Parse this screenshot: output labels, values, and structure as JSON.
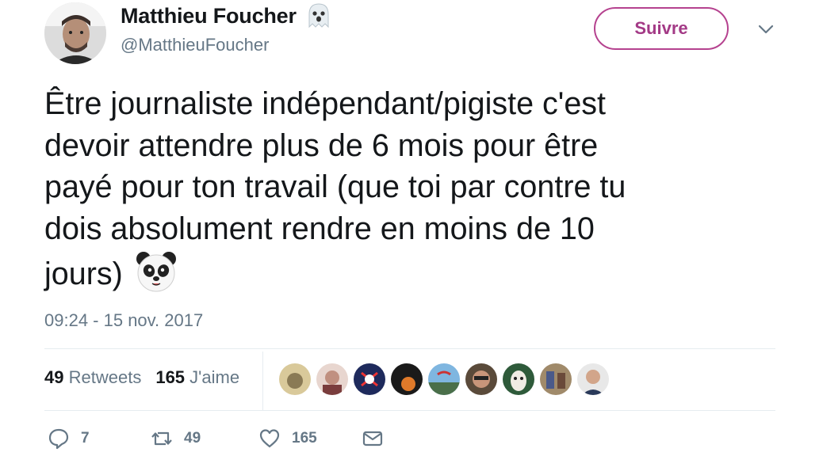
{
  "author": {
    "display_name": "Matthieu Foucher",
    "handle": "@MatthieuFoucher",
    "name_emoji": "ghost-emoji"
  },
  "follow_button": {
    "label": "Suivre",
    "color": "#b5428f"
  },
  "tweet": {
    "lines": [
      "Être journaliste indépendant/pigiste c'est",
      "devoir attendre plus de 6 mois pour être",
      "payé pour ton travail (que toi par contre tu",
      "dois absolument rendre en moins de 10",
      "jours)"
    ],
    "trailing_emoji": "panda-emoji",
    "timestamp": "09:24 - 15 nov. 2017"
  },
  "stats": {
    "retweets_count": "49",
    "retweets_label": "Retweets",
    "likes_count": "165",
    "likes_label": "J'aime"
  },
  "likers_count_shown": 9,
  "actions": {
    "reply_count": "7",
    "retweet_count": "49",
    "like_count": "165"
  }
}
